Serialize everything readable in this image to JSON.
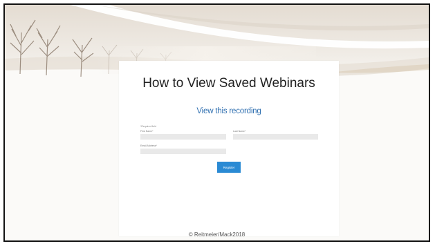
{
  "slide": {
    "title": "How to View Saved Webinars",
    "copyright": "© Reitmeier/Mack2018"
  },
  "form": {
    "heading": "View this recording",
    "required_note": "*Required field",
    "first_name_label": "First Name*",
    "last_name_label": "Last Name*",
    "email_label": "Email Address*",
    "register_label": "Register"
  },
  "colors": {
    "form_heading": "#2f6fb0",
    "button": "#2a8ad4",
    "input_bg": "#e9e9e9"
  }
}
